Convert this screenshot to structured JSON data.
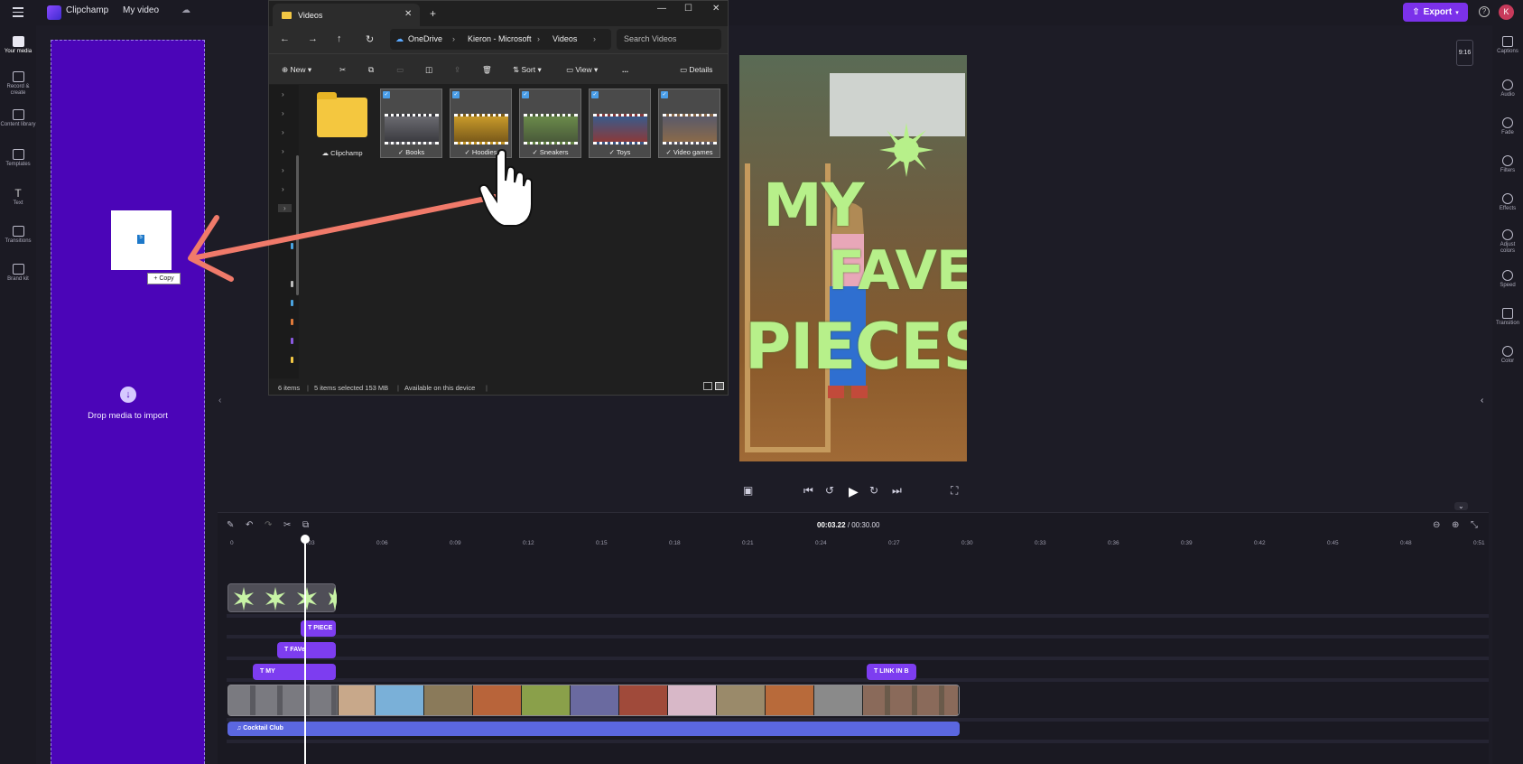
{
  "topbar": {
    "app_name": "Clipchamp",
    "project_title": "My video",
    "export_label": "Export",
    "avatar_initial": "K"
  },
  "left_sidebar": {
    "items": [
      {
        "label": "Your media",
        "icon": "folder-icon"
      },
      {
        "label": "Record & create",
        "icon": "camera-icon"
      },
      {
        "label": "Content library",
        "icon": "library-icon"
      },
      {
        "label": "Templates",
        "icon": "templates-icon"
      },
      {
        "label": "Text",
        "icon": "text-icon"
      },
      {
        "label": "Transitions",
        "icon": "transitions-icon"
      },
      {
        "label": "Brand kit",
        "icon": "brand-kit-icon"
      }
    ]
  },
  "dropzone": {
    "label": "Drop media to import",
    "copy_badge": "+ Copy"
  },
  "explorer": {
    "tab_title": "Videos",
    "breadcrumb": [
      "OneDrive",
      "Kieron - Microsoft",
      "Videos"
    ],
    "search_placeholder": "Search Videos",
    "toolbar": {
      "new": "New",
      "sort": "Sort",
      "view": "View",
      "more": "...",
      "details": "Details"
    },
    "folder": "Clipchamp",
    "files": [
      {
        "name": "Books",
        "checked": true
      },
      {
        "name": "Hoodies",
        "checked": true
      },
      {
        "name": "Sneakers",
        "checked": true
      },
      {
        "name": "Toys",
        "checked": true
      },
      {
        "name": "Video games",
        "checked": true
      }
    ],
    "status": {
      "count": "6 items",
      "selected": "5 items selected 153 MB",
      "availability": "Available on this device"
    }
  },
  "preview": {
    "overlay_lines": [
      "MY",
      "FAVE",
      "PIECES"
    ],
    "aspect_ratio": "9:16"
  },
  "right_sidebar": {
    "items": [
      "Captions",
      "Audio",
      "Fade",
      "Filters",
      "Effects",
      "Adjust colors",
      "Speed",
      "Transition",
      "Color"
    ]
  },
  "timeline": {
    "current_time": "00:03.22",
    "total_time": "00:30.00",
    "ruler": [
      "0",
      "0:03",
      "0:06",
      "0:09",
      "0:12",
      "0:15",
      "0:18",
      "0:21",
      "0:24",
      "0:27",
      "0:30",
      "0:33",
      "0:36",
      "0:39",
      "0:42",
      "0:45",
      "0:48",
      "0:51"
    ],
    "text_clips": [
      "PIECE",
      "FAVe",
      "MY",
      "LINK IN B"
    ],
    "audio_clip": "Cocktail Club"
  }
}
